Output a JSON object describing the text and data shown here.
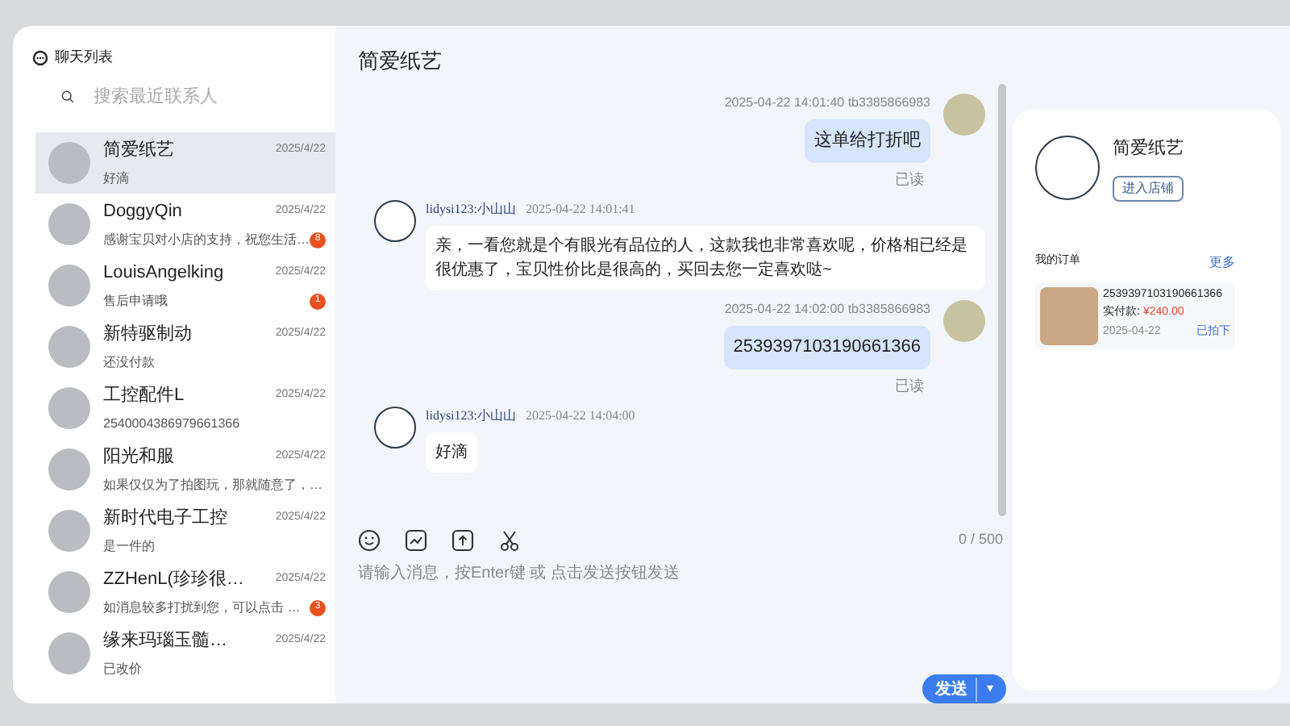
{
  "sidebar": {
    "title": "聊天列表",
    "search": {
      "placeholder": "搜索最近联系人"
    },
    "contacts": [
      {
        "name": "简爱纸艺",
        "preview": "好滴",
        "date": "2025/4/22",
        "selected": true
      },
      {
        "name": "DoggyQin",
        "preview": "感谢宝贝对小店的支持，祝您生活…",
        "date": "2025/4/22",
        "unread": "8",
        "selected": false
      },
      {
        "name": "LouisAngelking",
        "preview": "售后申请哦",
        "date": "2025/4/22",
        "unread": "1",
        "selected": false
      },
      {
        "name": "新特驱制动",
        "preview": "还没付款",
        "date": "2025/4/22",
        "selected": false
      },
      {
        "name": "工控配件L",
        "preview": "2540004386979661366",
        "date": "2025/4/22",
        "selected": false
      },
      {
        "name": "阳光和服",
        "preview": "如果仅仅为了拍图玩，那就随意了，…",
        "date": "2025/4/22",
        "selected": false
      },
      {
        "name": "新时代电子工控",
        "preview": "是一件的",
        "date": "2025/4/22",
        "selected": false
      },
      {
        "name": "ZZHenL(珍珍很…",
        "preview": "如消息较多打扰到您，可以点击 …",
        "date": "2025/4/22",
        "unread": "3",
        "selected": false
      },
      {
        "name": "缘来玛瑙玉髓…",
        "preview": "已改价",
        "date": "2025/4/22",
        "selected": false
      }
    ]
  },
  "chat": {
    "title": "简爱纸艺",
    "messages": [
      {
        "kind": "outgoing",
        "time": "2025-04-22 14:01:40",
        "sender": "tb3385866983",
        "text": "这单给打折吧",
        "status": "已读"
      },
      {
        "kind": "incoming",
        "time": "2025-04-22 14:01:41",
        "sender": "lidysi123:小山山",
        "text": "亲，一看您就是个有眼光有品位的人，这款我也非常喜欢呢，价格相已经是很优惠了，宝贝性价比是很高的，买回去您一定喜欢哒~"
      },
      {
        "kind": "outgoing",
        "time": "2025-04-22 14:02:00",
        "sender": "tb3385866983",
        "text": "2539397103190661366",
        "status": "已读"
      },
      {
        "kind": "incoming",
        "time": "2025-04-22 14:04:00",
        "sender": "lidysi123:小山山",
        "text": "好滴"
      }
    ],
    "composer": {
      "counter": "0 / 500",
      "placeholder": "请输入消息，按Enter键 或 点击发送按钮发送",
      "send_label": "发送",
      "dropdown_glyph": "▾"
    }
  },
  "shop_panel": {
    "shop_name": "简爱纸艺",
    "enter_shop": "进入店铺",
    "orders_title": "我的订单",
    "more": "更多",
    "orders": [
      {
        "number": "2539397103190661366",
        "paid_label": "实付款:",
        "amount": "¥240.00",
        "date": "2025-04-22",
        "status": "已拍下"
      }
    ]
  }
}
